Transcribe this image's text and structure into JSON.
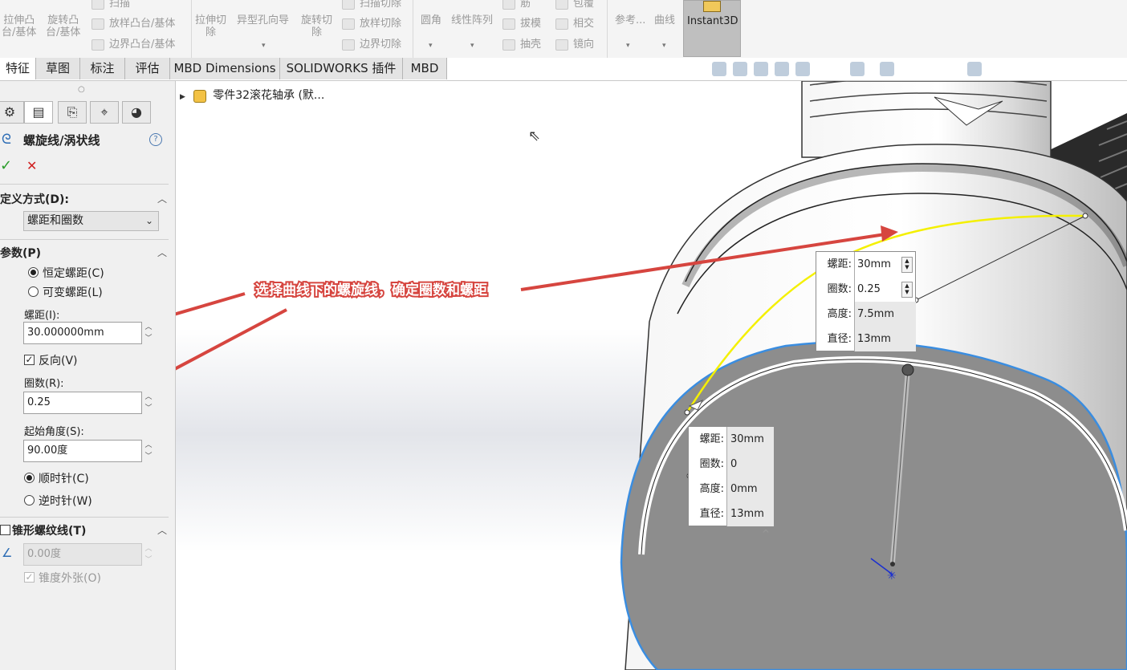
{
  "ribbon": {
    "extrude_boss": "拉伸凸\n台/基体",
    "revolve_boss": "旋转凸\n台/基体",
    "sweep": "扫描",
    "loft_boss": "放样凸台/基体",
    "boundary_boss": "边界凸台/基体",
    "extrude_cut": "拉伸切\n除",
    "hole_wizard": "异型孔向导",
    "revolve_cut": "旋转切\n除",
    "sweep_cut": "扫描切除",
    "loft_cut": "放样切除",
    "boundary_cut": "边界切除",
    "fillet": "圆角",
    "linear_pattern": "线性阵列",
    "rib": "筋",
    "draft": "拔模",
    "shell": "抽壳",
    "wrap": "包覆",
    "intersect": "相交",
    "mirror": "镜向",
    "reference": "参考...",
    "curves": "曲线",
    "instant3d": "Instant3D"
  },
  "tabs": [
    "特征",
    "草图",
    "标注",
    "评估",
    "MBD Dimensions",
    "SOLIDWORKS 插件",
    "MBD"
  ],
  "tree": {
    "root_label": "零件32滚花轴承 (默..."
  },
  "property_manager": {
    "title": "螺旋线/涡状线",
    "help": "?",
    "ok": "✓",
    "cancel": "✕",
    "definition": {
      "heading": "定义方式(D):",
      "selected": "螺距和圈数"
    },
    "parameters": {
      "heading": "参数(P)",
      "constant_pitch": "恒定螺距(C)",
      "variable_pitch": "可变螺距(L)",
      "pitch_label": "螺距(I):",
      "pitch_value": "30.000000mm",
      "reverse_label": "反向(V)",
      "reverse_checked": true,
      "revolutions_label": "圈数(R):",
      "revolutions_value": "0.25",
      "start_angle_label": "起始角度(S):",
      "start_angle_value": "90.00度",
      "clockwise": "顺时针(C)",
      "counterclockwise": "逆时针(W)"
    },
    "taper": {
      "heading": "锥形螺纹线(T)",
      "angle_value": "0.00度",
      "taper_outward": "锥度外张(O)"
    }
  },
  "annotation": {
    "text": "选择曲线下的螺旋线，确定圈数和螺距"
  },
  "callout_top": {
    "rows": [
      {
        "key": "螺距:",
        "value": "30mm"
      },
      {
        "key": "圈数:",
        "value": "0.25"
      },
      {
        "key": "高度:",
        "value": "7.5mm"
      },
      {
        "key": "直径:",
        "value": "13mm"
      }
    ]
  },
  "callout_bottom": {
    "rows": [
      {
        "key": "螺距:",
        "value": "30mm"
      },
      {
        "key": "圈数:",
        "value": "0"
      },
      {
        "key": "高度:",
        "value": "0mm"
      },
      {
        "key": "直径:",
        "value": "13mm"
      }
    ]
  },
  "colors": {
    "annotation_red": "#d6453f",
    "helix_yellow": "#f4f000",
    "edge_highlight_blue": "#3a8de0",
    "face_gray": "#8d8d8d"
  }
}
